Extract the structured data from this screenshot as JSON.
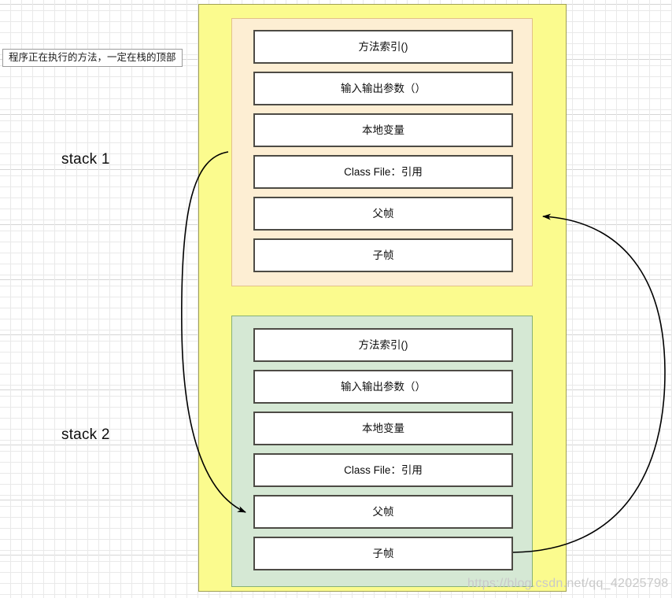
{
  "diagram": {
    "note": "程序正在执行的方法，一定在栈的顶部",
    "watermark": "https://blog.csdn.net/qq_42025798",
    "colors": {
      "outer_container": "#fbfb8e",
      "frame_panel_1": "#fdeed3",
      "frame_panel_2": "#d5e8d4",
      "box_fill": "#ffffff",
      "box_border": "#4d4b45",
      "arrow": "#000000"
    },
    "stacks": [
      {
        "label": "stack 1",
        "panel_name": "frame-panel-1",
        "boxes": [
          {
            "label": "方法索引()"
          },
          {
            "label": "输入输出参数（）"
          },
          {
            "label": "本地变量"
          },
          {
            "label": "Class File：引用"
          },
          {
            "label": "父帧"
          },
          {
            "label": "子帧"
          }
        ]
      },
      {
        "label": "stack 2",
        "panel_name": "frame-panel-2",
        "boxes": [
          {
            "label": "方法索引()"
          },
          {
            "label": "输入输出参数（）"
          },
          {
            "label": "本地变量"
          },
          {
            "label": "Class File：引用"
          },
          {
            "label": "父帧"
          },
          {
            "label": "子帧"
          }
        ]
      }
    ],
    "connectors": [
      {
        "name": "parent-frame-connector-left",
        "from": "stack-1 Class File：引用",
        "to": "stack-2 父帧",
        "direction": "down"
      },
      {
        "name": "child-frame-connector-right",
        "from": "stack-2 子帧",
        "to": "stack-1 父帧",
        "direction": "up"
      }
    ]
  }
}
